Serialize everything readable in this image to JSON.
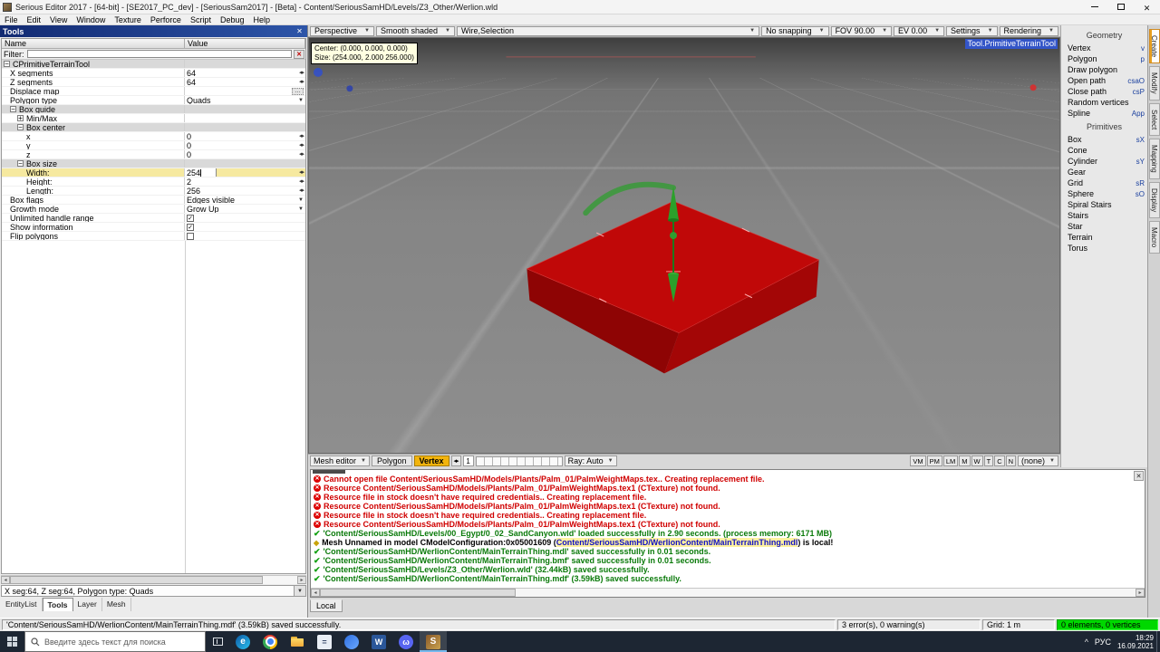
{
  "window": {
    "title": "Serious Editor 2017 - [64-bit] - [SE2017_PC_dev] - [SeriousSam2017] - [Beta] - Content/SeriousSamHD/Levels/Z3_Other/Werlion.wld"
  },
  "menu": {
    "items": [
      "File",
      "Edit",
      "View",
      "Window",
      "Texture",
      "Perforce",
      "Script",
      "Debug",
      "Help"
    ]
  },
  "colors": {
    "selection_yellow": "#f6e9a0",
    "error_red": "#d00000",
    "success_green": "#0a7a0a",
    "viewport_box_red": "#c00808",
    "gizmo_green": "#2ba02b",
    "tool_label_blue": "#3355c8",
    "elements_pane_green": "#00d800"
  },
  "tools_panel": {
    "title": "Tools",
    "columns": {
      "name": "Name",
      "value": "Value"
    },
    "filter_label": "Filter:",
    "filter_value": "",
    "rows": [
      {
        "name": "CPrimitiveTerrainTool",
        "value": "",
        "kind": "group",
        "ind": "ind0",
        "exp": "minus"
      },
      {
        "name": "X segments",
        "value": "64",
        "ind": "ind1",
        "ctrl": "spin"
      },
      {
        "name": "Z segments",
        "value": "64",
        "ind": "ind1",
        "ctrl": "spin"
      },
      {
        "name": "Displace map",
        "value": "",
        "ind": "ind1",
        "ctrl": "btn"
      },
      {
        "name": "Polygon type",
        "value": "Quads",
        "ind": "ind1",
        "ctrl": "drop"
      },
      {
        "name": "Box guide",
        "value": "",
        "kind": "group",
        "ind": "ind1",
        "exp": "minus"
      },
      {
        "name": "Min/Max",
        "value": "",
        "ind": "ind2",
        "exp": "plus"
      },
      {
        "name": "Box center",
        "value": "",
        "kind": "group",
        "ind": "ind2",
        "exp": "minus"
      },
      {
        "name": "x",
        "value": "0",
        "ind": "ind3",
        "ctrl": "spin"
      },
      {
        "name": "y",
        "value": "0",
        "ind": "ind3",
        "ctrl": "spin"
      },
      {
        "name": "z",
        "value": "0",
        "ind": "ind3",
        "ctrl": "spin"
      },
      {
        "name": "Box size",
        "value": "",
        "kind": "group",
        "ind": "ind2",
        "exp": "minus"
      },
      {
        "name": "Width:",
        "value": "254",
        "kind": "sel",
        "ind": "ind3",
        "ctrl": "spin",
        "caret": "caret"
      },
      {
        "name": "Height:",
        "value": "2",
        "ind": "ind3",
        "ctrl": "spin"
      },
      {
        "name": "Length:",
        "value": "256",
        "ind": "ind3",
        "ctrl": "spin"
      },
      {
        "name": "Box flags",
        "value": "Edges visible",
        "ind": "ind1",
        "ctrl": "drop"
      },
      {
        "name": "Growth mode",
        "value": "Grow Up",
        "ind": "ind1",
        "ctrl": "drop"
      },
      {
        "name": "Unlimited handle range",
        "value": "",
        "ind": "ind1",
        "cb": "on"
      },
      {
        "name": "Show information",
        "value": "",
        "ind": "ind1",
        "cb": "on"
      },
      {
        "name": "Flip polygons",
        "value": "",
        "ind": "ind1",
        "cb": "off"
      }
    ],
    "status": "X seg:64, Z seg:64, Polygon type: Quads",
    "tabs": [
      {
        "label": "EntityList"
      },
      {
        "label": "Tools",
        "cls": "sel"
      },
      {
        "label": "Layer"
      },
      {
        "label": "Mesh"
      }
    ]
  },
  "viewport": {
    "toolbar": {
      "items": [
        {
          "label": "Perspective"
        },
        {
          "label": "Smooth shaded"
        },
        {
          "label": "Wire,Selection",
          "cls": "grow"
        },
        {
          "label": "No snapping"
        },
        {
          "label": "FOV 90.00"
        },
        {
          "label": "EV  0.00"
        },
        {
          "label": "Settings"
        },
        {
          "label": "Rendering"
        }
      ]
    },
    "tool_label": "Tool.PrimitiveTerrainTool",
    "tooltip": {
      "line1": "Center: (0.000, 0.000, 0.000)",
      "line2": "Size: (254.000, 2.000 256.000)"
    },
    "bottombar": {
      "mesh_editor": "Mesh editor",
      "polygon": "Polygon",
      "vertex": "Vertex",
      "spin_value": "1",
      "ray": "Ray: Auto",
      "right_buttons": [
        {
          "label": "VM"
        },
        {
          "label": "PM"
        },
        {
          "label": "LM"
        },
        {
          "label": "M"
        },
        {
          "label": "W"
        },
        {
          "label": "T"
        },
        {
          "label": "C"
        },
        {
          "label": "N"
        }
      ],
      "none_dropdown": "(none)"
    }
  },
  "right_panel": {
    "geometry_header": "Geometry",
    "geometry_items": [
      {
        "label": "Vertex",
        "shortcut": "v"
      },
      {
        "label": "Polygon",
        "shortcut": "p"
      },
      {
        "label": "Draw polygon",
        "shortcut": ""
      },
      {
        "label": "Open path",
        "shortcut": "csaO"
      },
      {
        "label": "Close path",
        "shortcut": "csP"
      },
      {
        "label": "Random vertices",
        "shortcut": ""
      },
      {
        "label": "Spline",
        "shortcut": "App"
      }
    ],
    "primitives_header": "Primitives",
    "primitives_items": [
      {
        "label": "Box",
        "shortcut": "sX"
      },
      {
        "label": "Cone",
        "shortcut": ""
      },
      {
        "label": "Cylinder",
        "shortcut": "sY"
      },
      {
        "label": "Gear",
        "shortcut": ""
      },
      {
        "label": "Grid",
        "shortcut": "sR"
      },
      {
        "label": "Sphere",
        "shortcut": "sO"
      },
      {
        "label": "Spiral Stairs",
        "shortcut": ""
      },
      {
        "label": "Stairs",
        "shortcut": ""
      },
      {
        "label": "Star",
        "shortcut": ""
      },
      {
        "label": "Terrain",
        "shortcut": ""
      },
      {
        "label": "Torus",
        "shortcut": ""
      }
    ],
    "side_tabs": [
      {
        "label": "Create",
        "cls": "sel"
      },
      {
        "label": "Modify"
      },
      {
        "label": "Select"
      },
      {
        "label": "Mapping"
      },
      {
        "label": "Display"
      },
      {
        "label": "Macro"
      }
    ]
  },
  "log": {
    "tab": "Local",
    "lines": [
      {
        "cls": "err",
        "pre": "Cannot open file Content/SeriousSamHD/Models/Plants/Palm_01/PalmWeightMaps.tex.. Creating replacement file."
      },
      {
        "cls": "err",
        "pre": "Resource Content/SeriousSamHD/Models/Plants/Palm_01/PalmWeightMaps.tex1 (CTexture) not found."
      },
      {
        "cls": "err",
        "pre": "Resource file in stock doesn't have required credentials.. Creating replacement file."
      },
      {
        "cls": "err",
        "pre": "Resource Content/SeriousSamHD/Models/Plants/Palm_01/PalmWeightMaps.tex1 (CTexture) not found."
      },
      {
        "cls": "err",
        "pre": "Resource file in stock doesn't have required credentials.. Creating replacement file."
      },
      {
        "cls": "err",
        "pre": "Resource Content/SeriousSamHD/Models/Plants/Palm_01/PalmWeightMaps.tex1 (CTexture) not found."
      },
      {
        "cls": "ok",
        "pre": "'Content/SeriousSamHD/Levels/00_Egypt/0_02_SandCanyon.wld' loaded successfully in 2.90 seconds. (process memory: 6171 MB)"
      },
      {
        "cls": "info",
        "pre": "Mesh Unnamed in model CModelConfiguration:0x05001609 (",
        "link": "Content/SeriousSamHD/WerlionContent/MainTerrainThing.mdl",
        "post": ") is local!"
      },
      {
        "cls": "ok",
        "pre": "'Content/SeriousSamHD/WerlionContent/MainTerrainThing.mdl' saved successfully in 0.01 seconds."
      },
      {
        "cls": "ok",
        "pre": "'Content/SeriousSamHD/WerlionContent/MainTerrainThing.bmf' saved successfully in 0.01 seconds."
      },
      {
        "cls": "ok",
        "pre": "'Content/SeriousSamHD/Levels/Z3_Other/Werlion.wld' (32.44kB) saved successfully."
      },
      {
        "cls": "ok",
        "pre": "'Content/SeriousSamHD/WerlionContent/MainTerrainThing.mdf' (3.59kB) saved successfully."
      }
    ]
  },
  "statusbar": {
    "message": "'Content/SeriousSamHD/WerlionContent/MainTerrainThing.mdf' (3.59kB) saved successfully.",
    "errors": "3 error(s), 0 warning(s)",
    "grid": "Grid: 1 m",
    "elements": "0 elements, 0 vertices"
  },
  "taskbar": {
    "search_placeholder": "Введите здесь текст для поиска",
    "icons": [
      {
        "name": "edge-icon",
        "cls": "edge",
        "glyph": "e"
      },
      {
        "name": "chrome-icon",
        "cls": "chrome",
        "glyph": ""
      },
      {
        "name": "explorer-icon",
        "cls": "explorer",
        "glyph": ""
      },
      {
        "name": "calculator-icon",
        "cls": "calc",
        "glyph": "="
      },
      {
        "name": "blue-app-icon",
        "cls": "appblue",
        "glyph": ""
      },
      {
        "name": "word-icon",
        "cls": "word",
        "glyph": "W"
      },
      {
        "name": "discord-icon",
        "cls": "discord",
        "glyph": "ω"
      },
      {
        "name": "serious-editor-icon",
        "cls": "serious",
        "glyph": "S",
        "btncls": "active"
      }
    ],
    "tray": {
      "lang": "РУС",
      "time": "18:29",
      "date": "16.09.2021"
    }
  }
}
